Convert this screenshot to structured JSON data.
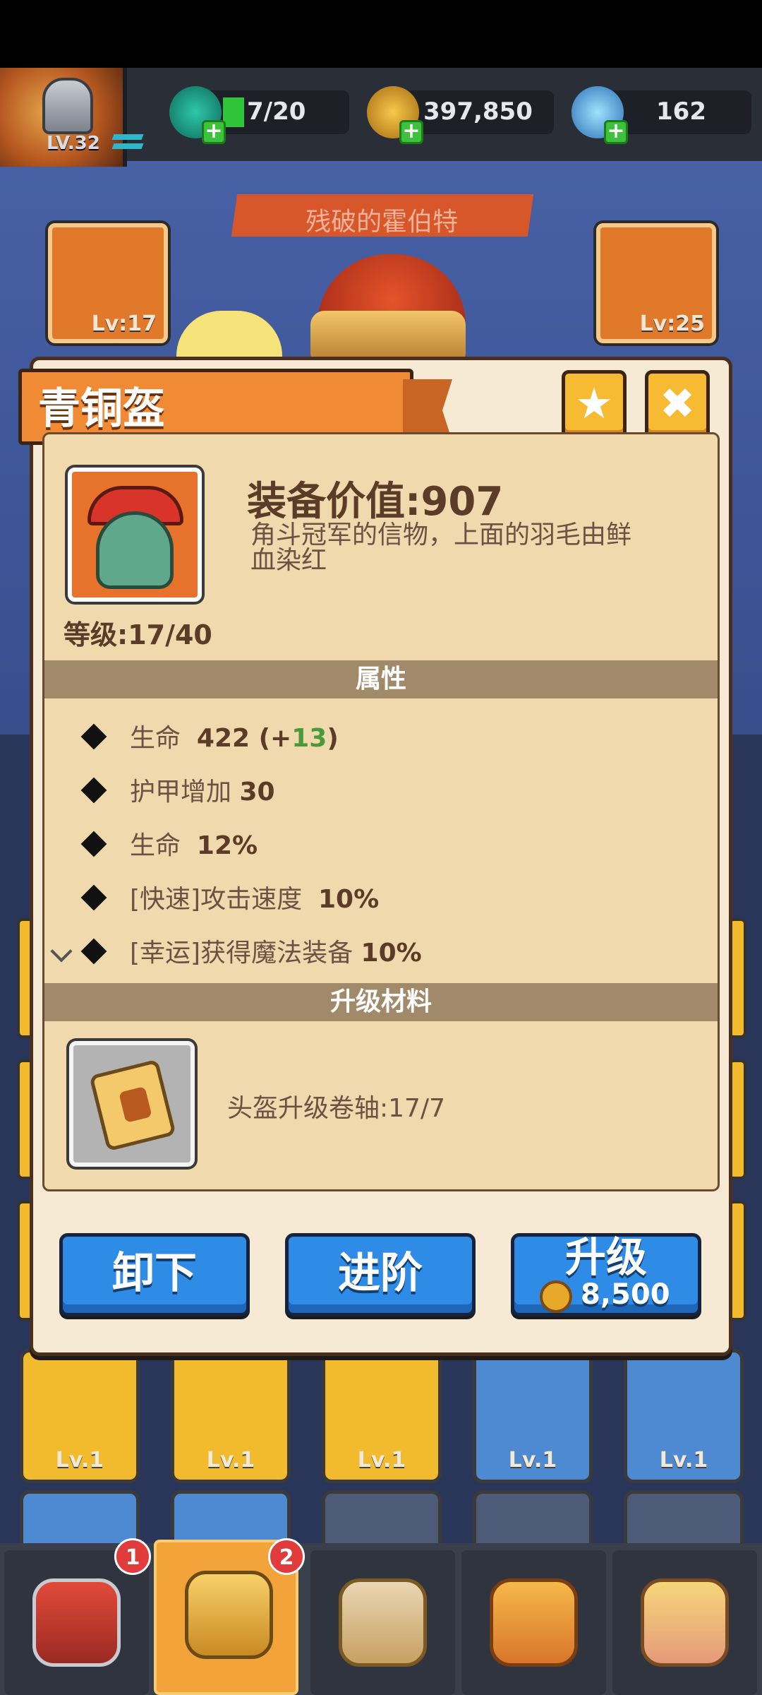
{
  "hud": {
    "player_level": "LV.32",
    "energy": "7/20",
    "gold": "397,850",
    "gems": "162",
    "colors": {
      "bar": "#2a2e36",
      "plus": "#3cc23b"
    }
  },
  "scene": {
    "hero_name": "残破的霍伯特",
    "left_slot_level": "Lv:17",
    "right_slot_level": "Lv:25",
    "grid_levels": [
      "Lv.1",
      "Lv.1",
      "Lv.1",
      "Lv.1",
      "Lv.1"
    ]
  },
  "dialog": {
    "title": "青铜盔",
    "favorite_icon": "star-icon",
    "close_icon": "close-icon",
    "item_icon": "bronze-helmet-icon",
    "equip_value": "装备价值:907",
    "description": "角斗冠军的信物，上面的羽毛由鲜血染红",
    "level": "等级:17/40",
    "attributes_header": "属性",
    "attributes": [
      {
        "name": "生命",
        "value": "422",
        "bonus_open": " (+",
        "bonus": "13",
        "bonus_close": ")"
      },
      {
        "name": "护甲增加",
        "value": "30"
      },
      {
        "name": "生命",
        "value": "12%"
      },
      {
        "name": "[快速]攻击速度",
        "value": "10%"
      },
      {
        "name": "[幸运]获得魔法装备",
        "value": "10%"
      }
    ],
    "materials_header": "升级材料",
    "material": {
      "icon": "upgrade-scroll-icon",
      "label": "头盔升级卷轴:17/7"
    },
    "buttons": {
      "unequip": "卸下",
      "advance": "进阶",
      "upgrade": "升级",
      "upgrade_cost": "8,500"
    }
  },
  "tabs": [
    {
      "name": "chest-icon",
      "badge": "1"
    },
    {
      "name": "helmet-icon",
      "badge": "2",
      "active": true
    },
    {
      "name": "swords-icon"
    },
    {
      "name": "book-icon"
    },
    {
      "name": "cards-icon"
    }
  ]
}
